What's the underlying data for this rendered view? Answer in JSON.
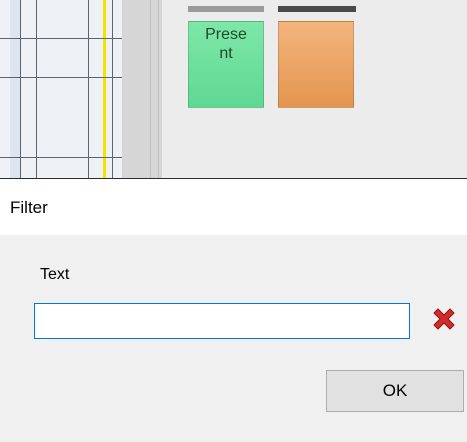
{
  "background_app": {
    "tiles": [
      {
        "label_line1": "Prese",
        "label_line2": "nt",
        "color": "#6ee3a0"
      },
      {
        "label_line1": "",
        "label_line2": "",
        "color": "#eba465"
      }
    ]
  },
  "dialog": {
    "title": "Filter",
    "text_label": "Text",
    "text_value": "",
    "text_placeholder": "",
    "clear_icon": "red-x-icon",
    "ok_label": "OK"
  }
}
